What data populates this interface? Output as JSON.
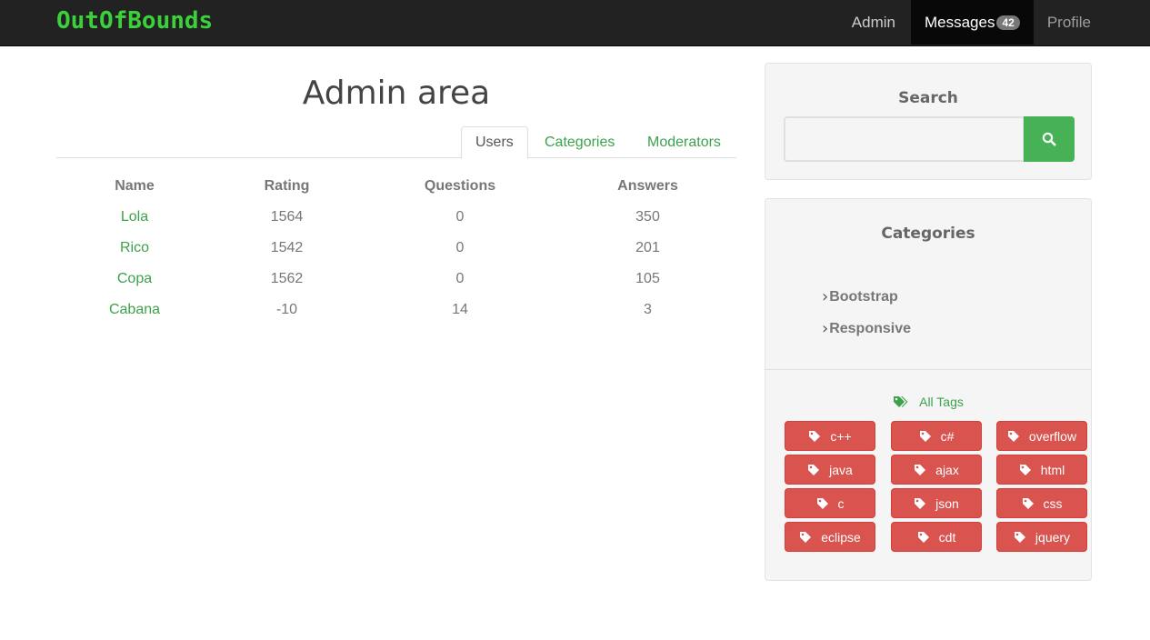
{
  "brand": "OutOfBounds",
  "nav": {
    "admin": "Admin",
    "messages": "Messages",
    "messages_count": "42",
    "profile": "Profile"
  },
  "main": {
    "title": "Admin area",
    "tabs": [
      "Users",
      "Categories",
      "Moderators"
    ],
    "columns": [
      "Name",
      "Rating",
      "Questions",
      "Answers"
    ],
    "rows": [
      {
        "name": "Lola",
        "rating": "1564",
        "questions": "0",
        "answers": "350"
      },
      {
        "name": "Rico",
        "rating": "1542",
        "questions": "0",
        "answers": "201"
      },
      {
        "name": "Copa",
        "rating": "1562",
        "questions": "0",
        "answers": "105"
      },
      {
        "name": "Cabana",
        "rating": "-10",
        "questions": "14",
        "answers": "3"
      }
    ]
  },
  "sidebar": {
    "search_heading": "Search",
    "search_value": "",
    "categories_heading": "Categories",
    "categories": [
      "Bootstrap",
      "Responsive"
    ],
    "all_tags": "All Tags",
    "tags": [
      "c++",
      "c#",
      "overflow",
      "java",
      "ajax",
      "html",
      "c",
      "json",
      "css",
      "eclipse",
      "cdt",
      "jquery"
    ]
  },
  "colors": {
    "brand": "#3bd13b",
    "link": "#3ca24a",
    "tag": "#d9534f",
    "search_button": "#47b155"
  }
}
